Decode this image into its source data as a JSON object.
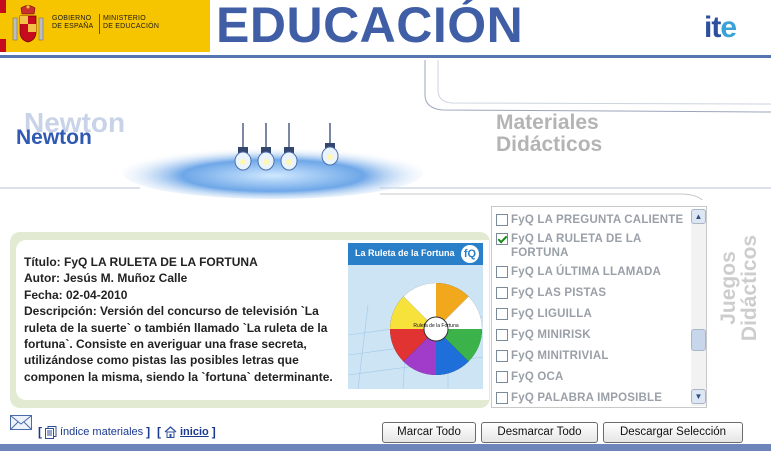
{
  "header": {
    "gov_line1": "GOBIERNO\nDE ESPAÑA",
    "gov_line2": "MINISTERIO\nDE EDUCACIÓN",
    "title": "EDUCACIÓN",
    "logo_main": "it",
    "logo_accent": "e"
  },
  "banner": {
    "newton_ghost": "Newton",
    "newton": "Newton",
    "materiales": "Materiales\nDidácticos"
  },
  "detail": {
    "titulo": "Título: FyQ LA RULETA DE LA FORTUNA",
    "autor": "Autor: Jesús M. Muñoz Calle",
    "fecha": "Fecha: 02-04-2010",
    "descripcion": "Descripción: Versión del concurso de televisión `La ruleta de la suerte` o también llamado `La ruleta de la fortuna`. Consiste en averiguar una frase secreta, utilizándose como pistas las posibles letras que componen la misma, siendo la `fortuna` determinante.",
    "thumbnail_title": "La Ruleta de la Fortuna",
    "thumbnail_center": "Ruleta de la Fortuna"
  },
  "list": {
    "items": [
      {
        "label": "FyQ LA PREGUNTA CALIENTE",
        "checked": false
      },
      {
        "label": "FyQ LA RULETA DE LA FORTUNA",
        "checked": true
      },
      {
        "label": "FyQ LA ÚLTIMA LLAMADA",
        "checked": false
      },
      {
        "label": "FyQ LAS PISTAS",
        "checked": false
      },
      {
        "label": "FyQ LIGUILLA",
        "checked": false
      },
      {
        "label": "FyQ MINIRISK",
        "checked": false
      },
      {
        "label": "FyQ MINITRIVIAL",
        "checked": false
      },
      {
        "label": "FyQ OCA",
        "checked": false
      },
      {
        "label": "FyQ PALABRA IMPOSIBLE",
        "checked": false
      }
    ],
    "scroll_position": 0.66
  },
  "side_label": "Juegos\nDidácticos",
  "footer": {
    "indice_label": "índice materiales",
    "inicio_label": "inicio",
    "open_bracket": "[",
    "close_bracket": "]",
    "btn_marcar": "Marcar Todo",
    "btn_desmarcar": "Desmarcar Todo",
    "btn_descargar": "Descargar Selección"
  },
  "colors": {
    "brand_blue": "#3f5ea6",
    "gov_yellow": "#f7c400",
    "panel_green": "#e2ebd2",
    "footer_blue": "#6d85b8"
  }
}
